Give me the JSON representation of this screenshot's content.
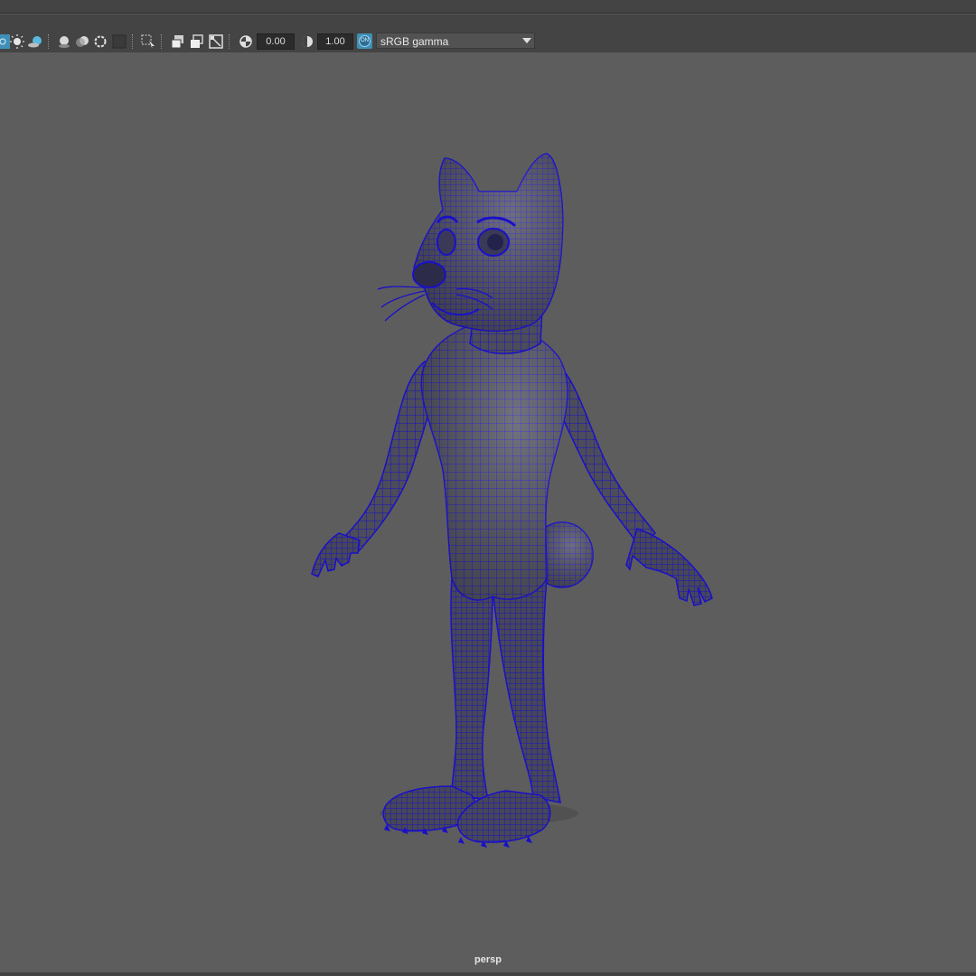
{
  "toolbar": {
    "exposure_value": "0.00",
    "gamma_value": "1.00",
    "colorspace_badge": "ON",
    "colorspace_label": "sRGB gamma",
    "icons": [
      "wireframe-toggle-icon",
      "lights-icon",
      "shadows-icon",
      "ambient-occlusion-icon",
      "motion-blur-icon",
      "anti-aliasing-icon",
      "depth-of-field-icon",
      "select-camera-icon",
      "isolate-select-icon",
      "xray-icon",
      "xray-joints-icon",
      "xray-components-icon",
      "exposure-icon",
      "gamma-icon",
      "color-management-icon",
      "dropdown-arrow-icon"
    ]
  },
  "viewport": {
    "camera_label": "persp",
    "mesh_wire_color": "#1a10c8",
    "background_color": "#5d5d5d"
  }
}
